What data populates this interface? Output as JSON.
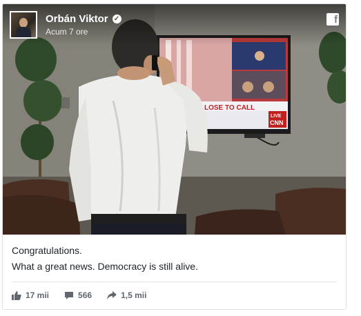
{
  "post": {
    "author": "Orbán Viktor",
    "verified_badge": "verified-check-icon",
    "timestamp": "Acum 7 ore",
    "platform_icon": "facebook-icon",
    "caption_line1": "Congratulations.",
    "caption_line2": "What a great news. Democracy is still alive."
  },
  "tv_screen": {
    "banner": "LOSE TO CALL",
    "corner_badge": "LIVE",
    "network": "CNN"
  },
  "stats": {
    "likes": "17 mii",
    "comments": "566",
    "shares": "1,5 mii"
  },
  "colors": {
    "text": "#1d2129",
    "muted": "#606770",
    "border": "#dddfe2"
  }
}
